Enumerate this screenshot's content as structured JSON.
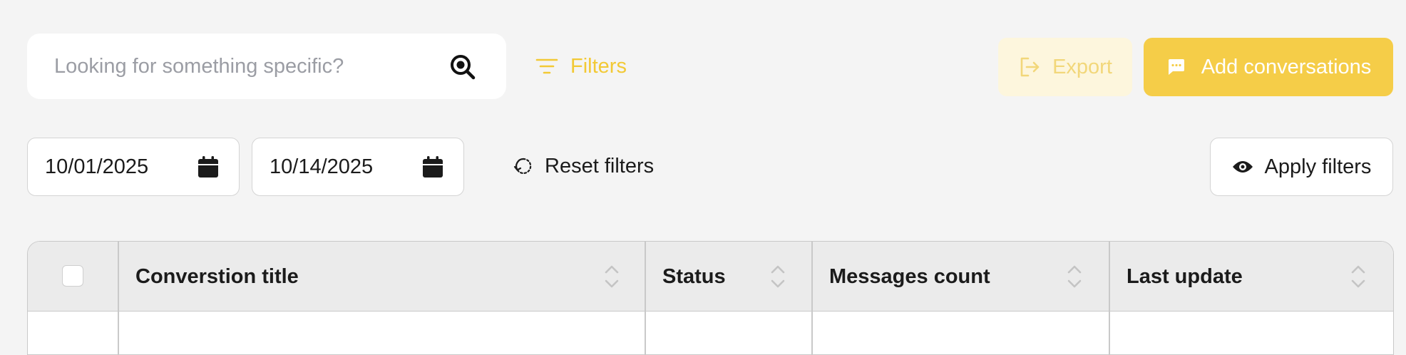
{
  "search": {
    "placeholder": "Looking for something specific?",
    "icon": "search-icon"
  },
  "toolbar": {
    "filters_label": "Filters",
    "export_label": "Export",
    "add_label": "Add conversations"
  },
  "filters": {
    "start_date": "10/01/2025",
    "end_date": "10/14/2025",
    "reset_label": "Reset filters",
    "apply_label": "Apply filters"
  },
  "table": {
    "columns": [
      {
        "label": "Converstion title"
      },
      {
        "label": "Status"
      },
      {
        "label": "Messages count"
      },
      {
        "label": "Last update"
      }
    ]
  },
  "colors": {
    "accent": "#f5cd48",
    "accent_text": "#f2c935",
    "export_bg": "#fdf6dd",
    "background": "#f4f4f4"
  }
}
